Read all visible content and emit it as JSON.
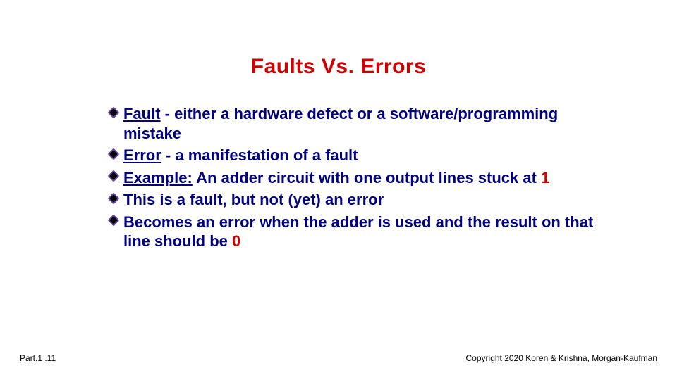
{
  "title": "Faults Vs. Errors",
  "bullets": [
    {
      "underlinedLead": "Fault",
      "rest": " - either a hardware defect or a software/programming mistake"
    },
    {
      "underlinedLead": "Error",
      "rest": " - a manifestation of a fault"
    },
    {
      "underlinedLead": "Example:",
      "rest1": " An adder circuit with one output lines stuck at ",
      "redTail": "1"
    },
    {
      "plain": "This is a fault, but not (yet) an error"
    },
    {
      "rest1": "Becomes an error when the adder is used and the result on that line should be ",
      "redTail": "0"
    }
  ],
  "footer": {
    "left": "Part.1 .11",
    "right": "Copyright 2020 Koren & Krishna, Morgan-Kaufman"
  }
}
